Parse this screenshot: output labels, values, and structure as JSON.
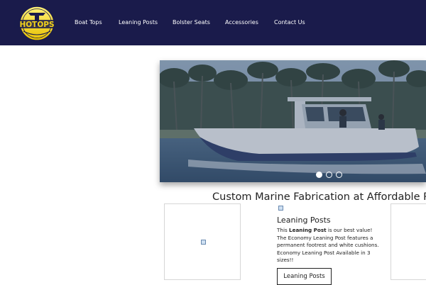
{
  "header": {
    "background_color": "#1a1b4b",
    "logo": {
      "text": "HOTOPS"
    },
    "nav": [
      {
        "label": "Boat Tops"
      },
      {
        "label": "Leaning Posts"
      },
      {
        "label": "Bolster Seats"
      },
      {
        "label": "Accessories"
      },
      {
        "label": "Contact Us"
      }
    ]
  },
  "hero": {
    "slide_count": 3,
    "active_slide": 1
  },
  "tagline": "Custom Marine Fabrication at Affordable Pri",
  "product": {
    "title": "Leaning Posts",
    "desc_prefix": "This ",
    "desc_bold": "Leaning Post",
    "desc_suffix": " is our best value! The Economy Leaning Post features a permanent footrest and white cushions. Economy Leaning Post Available in 3 sizes!!",
    "button_label": "Leaning Posts"
  }
}
